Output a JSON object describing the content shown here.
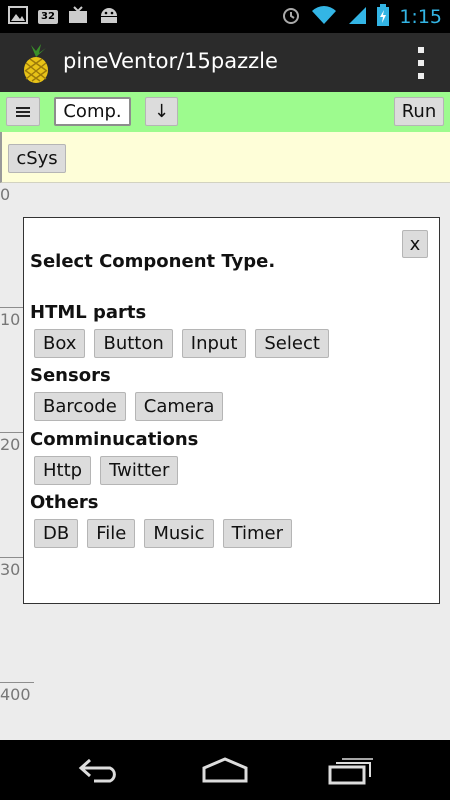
{
  "status_bar": {
    "time": "1:15",
    "badge": "32",
    "colors": {
      "background": "#000000",
      "time": "#33b5e5",
      "wifi": "#33b5e5",
      "battery": "#33b5e5"
    }
  },
  "action_bar": {
    "title": "pineVentor/15pazzle"
  },
  "toolbar": {
    "comp_label": "Comp.",
    "down_label": "↓",
    "run_label": "Run",
    "background": "#9dfb8e"
  },
  "sysbar": {
    "csys_label": "cSys",
    "background": "#fefed8"
  },
  "ruler": {
    "labels": [
      "0",
      "10",
      "20",
      "30",
      "400"
    ]
  },
  "dialog": {
    "close_label": "x",
    "title": "Select Component Type.",
    "sections": [
      {
        "title": "HTML parts",
        "items": [
          "Box",
          "Button",
          "Input",
          "Select"
        ]
      },
      {
        "title": "Sensors",
        "items": [
          "Barcode",
          "Camera"
        ]
      },
      {
        "title": "Comminucations",
        "items": [
          "Http",
          "Twitter"
        ]
      },
      {
        "title": "Others",
        "items": [
          "DB",
          "File",
          "Music",
          "Timer"
        ]
      }
    ]
  },
  "nav_bar": {
    "icons": [
      "back-icon",
      "home-icon",
      "recent-apps-icon"
    ]
  }
}
